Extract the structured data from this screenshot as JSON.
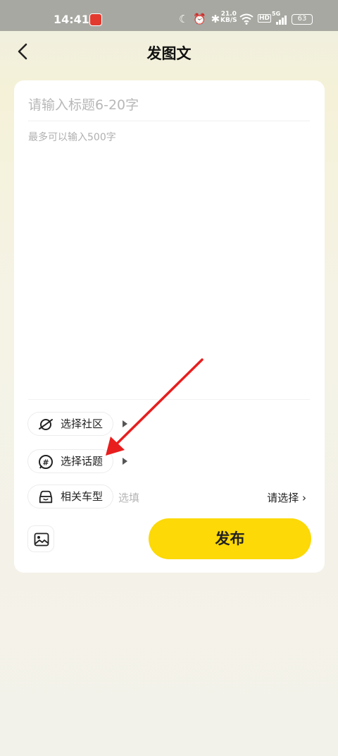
{
  "status_bar": {
    "time": "14:41",
    "network_speed_value": "21.0",
    "network_speed_unit": "KB/S",
    "hd_label": "HD",
    "network_type": "5G",
    "battery": "63"
  },
  "navbar": {
    "title": "发图文",
    "back_icon": "chevron-left-icon"
  },
  "editor": {
    "title_placeholder": "请输入标题6-20字",
    "body_placeholder": "最多可以输入500字"
  },
  "options": {
    "community": {
      "label": "选择社区",
      "icon": "planet-icon"
    },
    "topic": {
      "label": "选择话题",
      "icon": "hashtag-icon"
    },
    "car_model": {
      "label": "相关车型",
      "icon": "car-icon",
      "optional_text": "选填",
      "select_label": "请选择",
      "select_chevron": "›"
    }
  },
  "actions": {
    "image_icon": "image-icon",
    "publish_label": "发布"
  },
  "colors": {
    "accent": "#fcd907",
    "annotation_arrow": "#e81e1e"
  }
}
